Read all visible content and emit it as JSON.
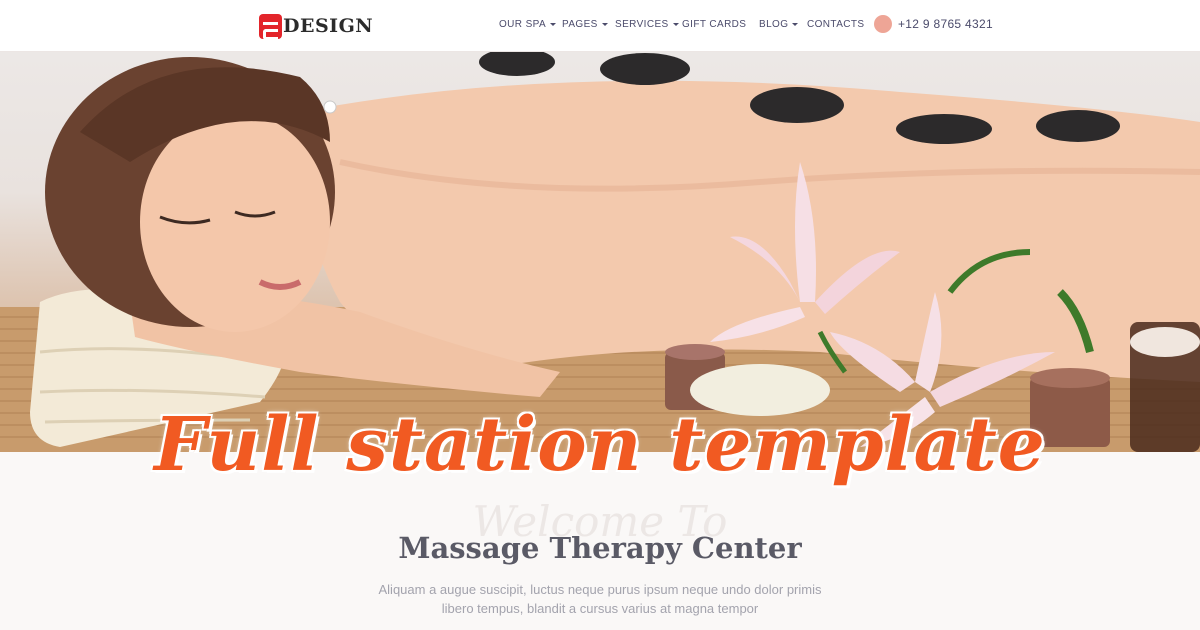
{
  "brand": {
    "logo_text": "DESIGN"
  },
  "nav": {
    "items": [
      {
        "label": "OUR SPA",
        "dropdown": true
      },
      {
        "label": "PAGES",
        "dropdown": true
      },
      {
        "label": "SERVICES",
        "dropdown": true
      },
      {
        "label": "GIFT CARDS",
        "dropdown": false
      },
      {
        "label": "BLOG",
        "dropdown": true
      },
      {
        "label": "CONTACTS",
        "dropdown": false
      }
    ],
    "phone": "+12 9 8765 4321"
  },
  "hero": {
    "overlay_title": "Full station template"
  },
  "welcome": {
    "script": "Welcome To",
    "title": "Massage Therapy Center",
    "line1": "Aliquam a augue suscipit, luctus neque purus ipsum neque undo dolor primis",
    "line2": "libero tempus, blandit a cursus varius at magna tempor"
  },
  "colors": {
    "accent": "#f15a22",
    "logo_red": "#e3252b",
    "phone_dot": "#eea596",
    "nav_text": "#4b4b6b"
  },
  "icons": [
    "logo-mark-icon",
    "caret-down-icon",
    "phone-icon"
  ]
}
